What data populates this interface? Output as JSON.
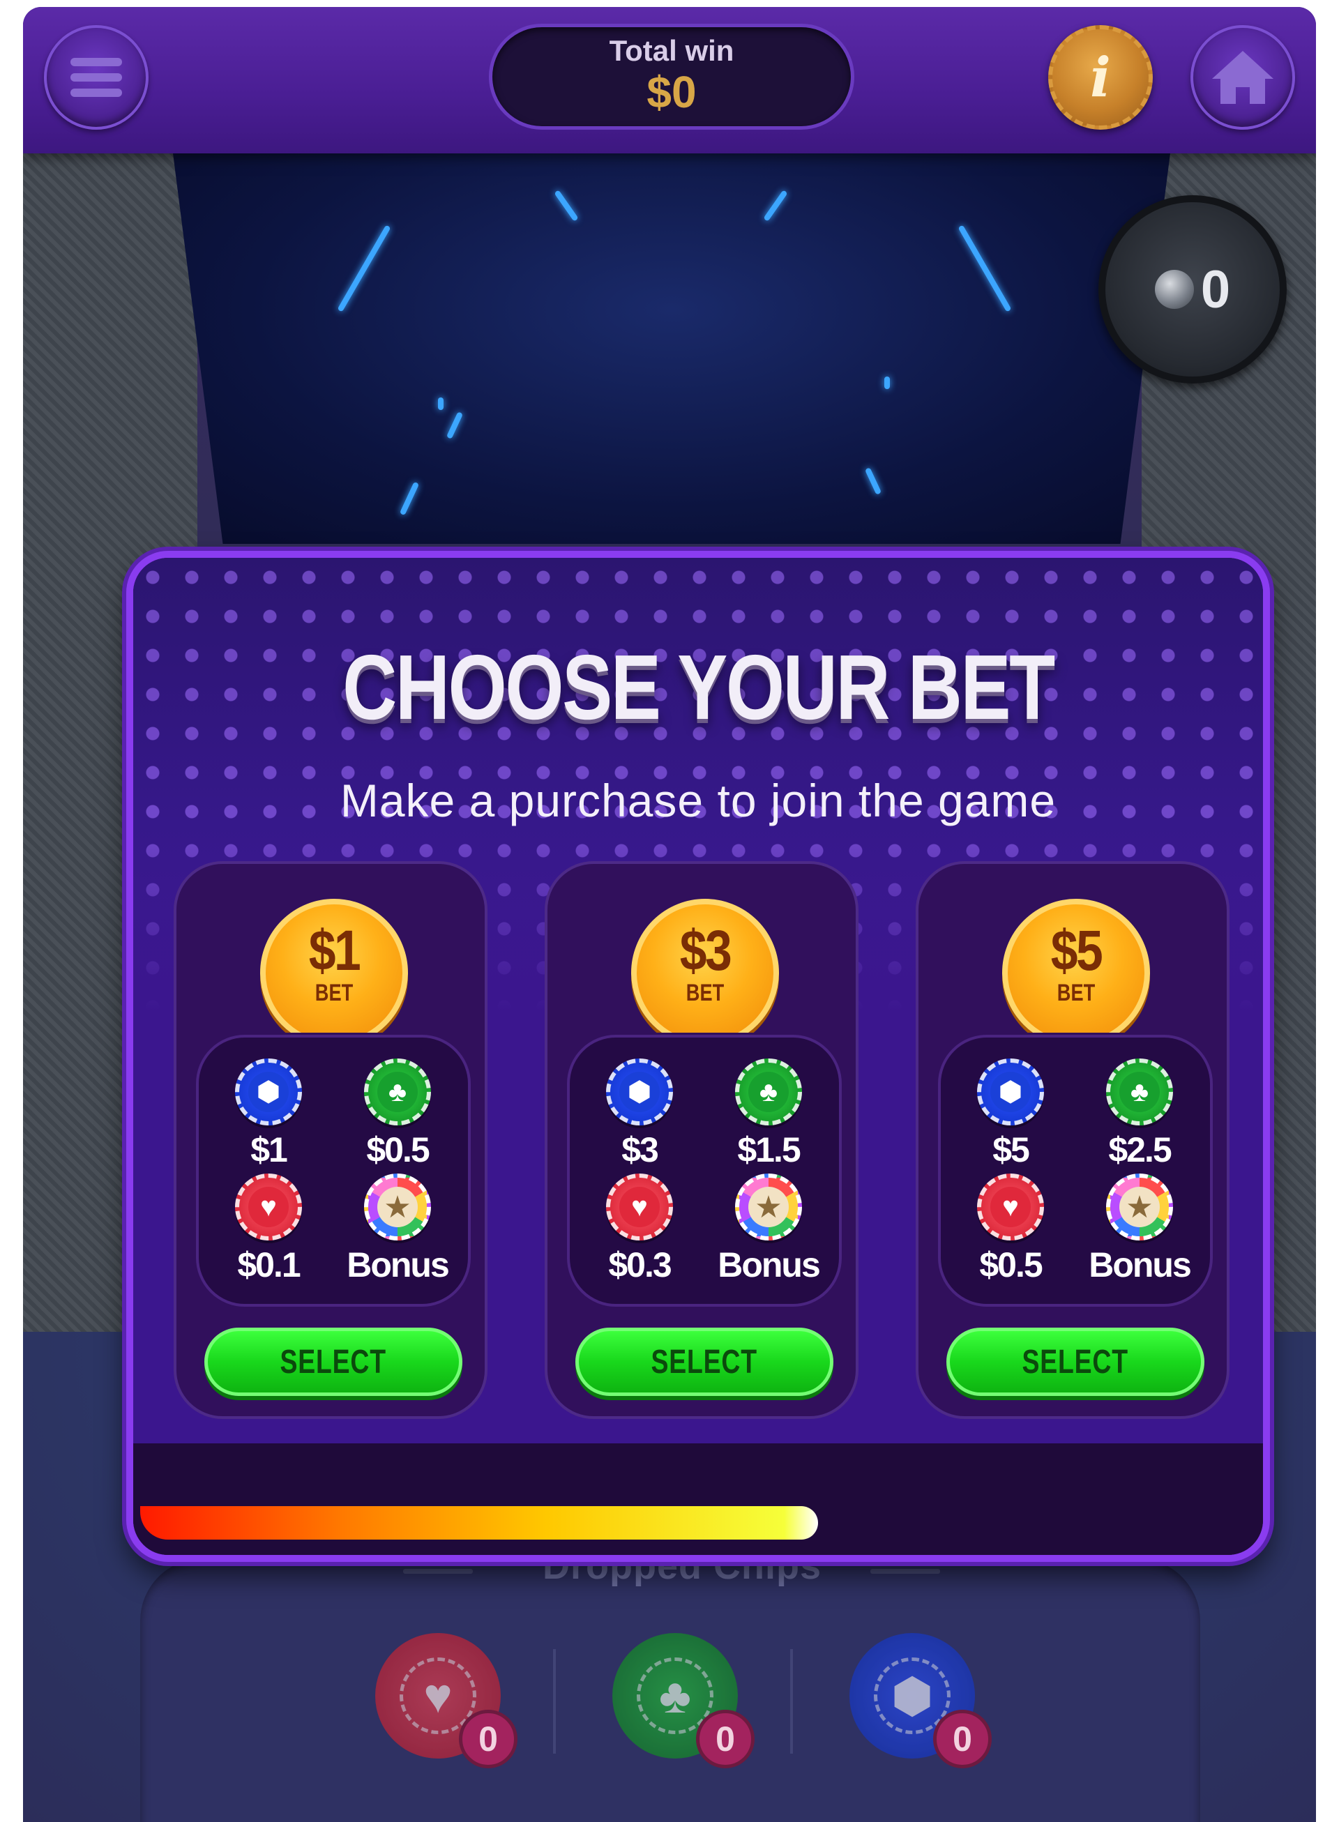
{
  "header": {
    "total_win_label": "Total win",
    "total_win_value": "$0",
    "info_label": "i"
  },
  "game": {
    "balls_count": "0"
  },
  "modal": {
    "title": "CHOOSE YOUR BET",
    "subtitle": "Make a purchase to join the game",
    "timer_progress": 0.6,
    "bets": [
      {
        "amount": "$1",
        "bet_label": "BET",
        "chips": [
          {
            "type": "blue",
            "label": "$1"
          },
          {
            "type": "green",
            "label": "$0.5"
          },
          {
            "type": "red",
            "label": "$0.1"
          },
          {
            "type": "bonus",
            "label": "Bonus"
          }
        ],
        "select_label": "SELECT"
      },
      {
        "amount": "$3",
        "bet_label": "BET",
        "chips": [
          {
            "type": "blue",
            "label": "$3"
          },
          {
            "type": "green",
            "label": "$1.5"
          },
          {
            "type": "red",
            "label": "$0.3"
          },
          {
            "type": "bonus",
            "label": "Bonus"
          }
        ],
        "select_label": "SELECT"
      },
      {
        "amount": "$5",
        "bet_label": "BET",
        "chips": [
          {
            "type": "blue",
            "label": "$5"
          },
          {
            "type": "green",
            "label": "$2.5"
          },
          {
            "type": "red",
            "label": "$0.5"
          },
          {
            "type": "bonus",
            "label": "Bonus"
          }
        ],
        "select_label": "SELECT"
      }
    ]
  },
  "dropped": {
    "title": "Dropped Chips",
    "chips": [
      {
        "type": "red",
        "icon": "heart-icon",
        "count": "0"
      },
      {
        "type": "green",
        "icon": "club-icon",
        "count": "0"
      },
      {
        "type": "blue",
        "icon": "hexagon-icon",
        "count": "0"
      }
    ]
  },
  "colors": {
    "accent_purple": "#8a3cf0",
    "select_green": "#19d81c",
    "coin_gold": "#ffb018"
  }
}
